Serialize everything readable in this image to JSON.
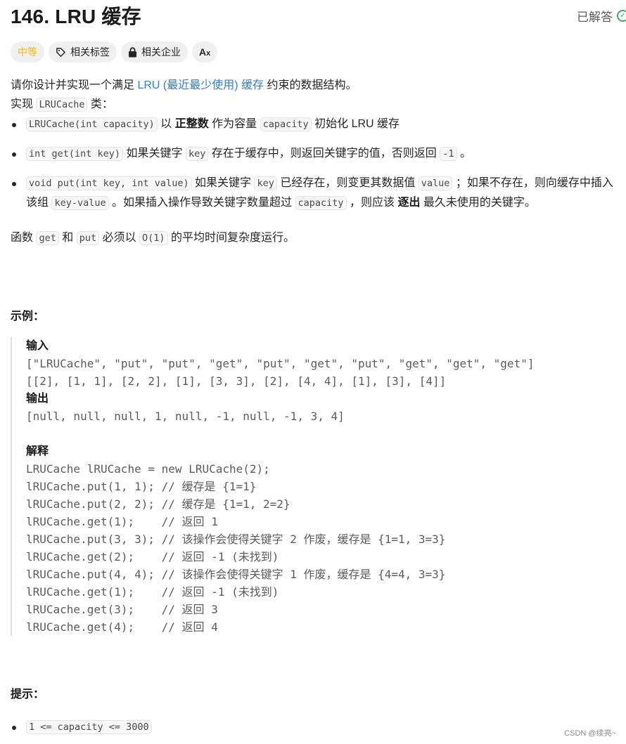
{
  "header": {
    "title": "146. LRU 缓存",
    "solved_label": "已解答",
    "solved_icon": "check-circle-icon"
  },
  "chips": {
    "difficulty": "中等",
    "tags": {
      "label": "相关标签",
      "icon": "tag-icon"
    },
    "companies": {
      "label": "相关企业",
      "icon": "lock-icon"
    },
    "translate": {
      "label": "Aあ",
      "icon": "translate-icon"
    }
  },
  "colors": {
    "difficulty_medium": "#ffb800",
    "link": "#2f7fd8",
    "solved_green": "#2db55d"
  },
  "description": {
    "intro_pre": "请你设计并实现一个满足 ",
    "intro_link": "LRU (最近最少使用) 缓存",
    "intro_post": " 约束的数据结构。",
    "impl_pre": "实现 ",
    "impl_code": "LRUCache",
    "impl_post": " 类：",
    "items": [
      {
        "code1": "LRUCache(int capacity)",
        "t1": " 以 ",
        "bold": "正整数",
        "t2": " 作为容量 ",
        "code2": "capacity",
        "t3": " 初始化 LRU 缓存"
      },
      {
        "code1": "int get(int key)",
        "t1": " 如果关键字 ",
        "code2": "key",
        "t2": " 存在于缓存中，则返回关键字的值，否则返回 ",
        "code3": "-1",
        "t3": " 。"
      },
      {
        "code1": "void put(int key, int value)",
        "t1": " 如果关键字 ",
        "code2": "key",
        "t2": " 已经存在，则变更其数据值 ",
        "code3": "value",
        "t3": " ；如果不存在，则向缓存中插入该组 ",
        "code4": "key-value",
        "t4": " 。如果插入操作导致关键字数量超过 ",
        "code5": "capacity",
        "t5": " ，则应该 ",
        "bold": "逐出",
        "t6": " 最久未使用的关键字。"
      }
    ],
    "complexity_pre": "函数 ",
    "complexity_code1": "get",
    "complexity_mid": " 和 ",
    "complexity_code2": "put",
    "complexity_mid2": " 必须以 ",
    "complexity_code3": "O(1)",
    "complexity_post": " 的平均时间复杂度运行。"
  },
  "example": {
    "heading": "示例：",
    "input_label": "输入",
    "input_lines": [
      "[\"LRUCache\", \"put\", \"put\", \"get\", \"put\", \"get\", \"put\", \"get\", \"get\", \"get\"]",
      "[[2], [1, 1], [2, 2], [1], [3, 3], [2], [4, 4], [1], [3], [4]]"
    ],
    "output_label": "输出",
    "output_line": "[null, null, null, 1, null, -1, null, -1, 3, 4]",
    "explain_label": "解释",
    "explain_lines": [
      "LRUCache lRUCache = new LRUCache(2);",
      "lRUCache.put(1, 1); // 缓存是 {1=1}",
      "lRUCache.put(2, 2); // 缓存是 {1=1, 2=2}",
      "lRUCache.get(1);    // 返回 1",
      "lRUCache.put(3, 3); // 该操作会使得关键字 2 作废，缓存是 {1=1, 3=3}",
      "lRUCache.get(2);    // 返回 -1 (未找到)",
      "lRUCache.put(4, 4); // 该操作会使得关键字 1 作废，缓存是 {4=4, 3=3}",
      "lRUCache.get(1);    // 返回 -1 (未找到)",
      "lRUCache.get(3);    // 返回 3",
      "lRUCache.get(4);    // 返回 4"
    ]
  },
  "constraints": {
    "heading": "提示：",
    "items": [
      "1 <= capacity <= 3000"
    ]
  },
  "watermark": "CSDN @续亮~"
}
